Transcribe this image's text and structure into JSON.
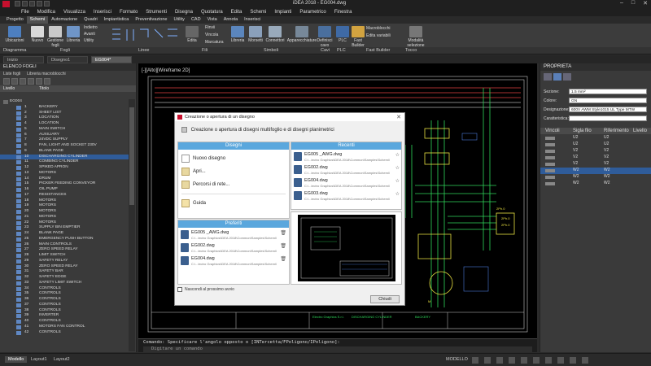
{
  "app": {
    "window_title": "iDEA 2018 - EG004.dwg"
  },
  "menu": [
    "File",
    "Modifica",
    "Visualizza",
    "Inserisci",
    "Formato",
    "Strumenti",
    "Disegna",
    "Quotatura",
    "Edita",
    "Schemi",
    "Impianti",
    "Parametrico",
    "Finestra"
  ],
  "ribbon_tabs": [
    "Progetto",
    "Schemi",
    "Automazione",
    "Quadri",
    "Impiantistica",
    "Preventivazione",
    "Utility",
    "CAD",
    "Vista",
    "Annota",
    "Inserisci"
  ],
  "ribbon_active_tab": "Schemi",
  "ribbon": {
    "buttons": {
      "ubicazioni": "Ubicazioni",
      "nuovo": "Nuovo",
      "gestione_fogli": "Gestione fogli",
      "libreria": "Libreria",
      "indietro": "Indietro",
      "avanti": "Avanti",
      "utility": "Utility",
      "edita": "Edita",
      "rinvii": "Rinvii",
      "vincola": "Vincola",
      "marcatura": "Marcatura",
      "libreria2": "Libreria",
      "morsetti": "Morsetti",
      "connettori": "Connettori",
      "apparecchiature": "Apparecchiature",
      "definisci_cavo": "Definisci cavo",
      "plc": "PLC",
      "macroblocchi": "Macroblocchi",
      "edita_variabili": "Edita variabili",
      "fast_builder": "Fast Builder",
      "modalita_selezione": "Modalità selezione"
    },
    "groups": [
      "Diagramma",
      "Fogli",
      "Linee",
      "Fili",
      "Simboli",
      "Cavi",
      "PLC",
      "Fast Builder",
      "Tocco"
    ]
  },
  "doc_tabs": [
    "Inizio",
    "Disegno1",
    "EG004*"
  ],
  "left_panel": {
    "title": "ELENCO FOGLI",
    "subtabs": [
      "Liste fogli",
      "Libreria macroblocchi"
    ],
    "columns": {
      "livello": "Livello",
      "titolo": "Titolo"
    },
    "root": "EG004",
    "sheets": [
      {
        "num": "1",
        "title": "BACKERY"
      },
      {
        "num": "2",
        "title": "SHEET LIST"
      },
      {
        "num": "3",
        "title": "LOCATION"
      },
      {
        "num": "4",
        "title": "LOCATION"
      },
      {
        "num": "5",
        "title": "MAIN SWITCH"
      },
      {
        "num": "6",
        "title": "AUXILIARY"
      },
      {
        "num": "7",
        "title": "24VDC SUPPLY"
      },
      {
        "num": "8",
        "title": "FAN, LIGHT AND SOCKET 230V"
      },
      {
        "num": "9",
        "title": "BLANK PAGE"
      },
      {
        "num": "10",
        "title": "DISCHARGING CYLINDER"
      },
      {
        "num": "11",
        "title": "COMBING CYLINDER"
      },
      {
        "num": "12",
        "title": "SPIKED APRON"
      },
      {
        "num": "13",
        "title": "MOTORS"
      },
      {
        "num": "14",
        "title": "DRUM"
      },
      {
        "num": "15",
        "title": "PICKER FEEDING CONVEYOR"
      },
      {
        "num": "16",
        "title": "OIL PUMP"
      },
      {
        "num": "17",
        "title": "RESISTANCES"
      },
      {
        "num": "18",
        "title": "MOTORS"
      },
      {
        "num": "19",
        "title": "MOTORS"
      },
      {
        "num": "20",
        "title": "MOTORS"
      },
      {
        "num": "21",
        "title": "MOTORS"
      },
      {
        "num": "22",
        "title": "MOTORS"
      },
      {
        "num": "23",
        "title": "SUPPLY BIN EMPTIER"
      },
      {
        "num": "24",
        "title": "BLANK PAGE"
      },
      {
        "num": "25",
        "title": "EMERGENCY PUSH BUTTON"
      },
      {
        "num": "26",
        "title": "MAIN CONTROLS"
      },
      {
        "num": "27",
        "title": "ZERO SPEED RELAY"
      },
      {
        "num": "28",
        "title": "LIMIT SWITCH"
      },
      {
        "num": "29",
        "title": "SAFETY RELAY"
      },
      {
        "num": "30",
        "title": "ZERO SPEED RELAY"
      },
      {
        "num": "31",
        "title": "SAFETY BAR"
      },
      {
        "num": "32",
        "title": "SAFETY EDGE"
      },
      {
        "num": "33",
        "title": "SAFETY LIMIT SWITCH"
      },
      {
        "num": "34",
        "title": "CONTROLS"
      },
      {
        "num": "35",
        "title": "CONTROLS"
      },
      {
        "num": "36",
        "title": "CONTROLS"
      },
      {
        "num": "37",
        "title": "CONTROLS"
      },
      {
        "num": "38",
        "title": "CONTROLS"
      },
      {
        "num": "39",
        "title": "INVERTER"
      },
      {
        "num": "40",
        "title": "CONTROLS"
      },
      {
        "num": "41",
        "title": "MOTORS FAN CONTROL"
      },
      {
        "num": "42",
        "title": "CONTROLS"
      }
    ],
    "selected_index": 9
  },
  "properties": {
    "title": "PROPRIETA",
    "fields": [
      {
        "label": "Sezione:",
        "value": "1.5 mm²"
      },
      {
        "label": "Colore:",
        "value": "GN"
      },
      {
        "label": "Designazione:",
        "value": "600V AWM Style1015 UL Type MTW"
      },
      {
        "label": "Caratteristica:",
        "value": ""
      }
    ],
    "wire_columns": {
      "vincoli": "Vincoli",
      "sigla": "Sigla filo",
      "riferimento": "Riferimento",
      "livello": "Livello"
    },
    "wires": [
      {
        "sigla": "U2",
        "rif": "U2"
      },
      {
        "sigla": "U2",
        "rif": "U2"
      },
      {
        "sigla": "V2",
        "rif": "V2"
      },
      {
        "sigla": "V2",
        "rif": "V2"
      },
      {
        "sigla": "V2",
        "rif": "V2"
      },
      {
        "sigla": "W2",
        "rif": "W2"
      },
      {
        "sigla": "W2",
        "rif": "W2"
      },
      {
        "sigla": "W2",
        "rif": "W2"
      }
    ],
    "selected_wire": 5
  },
  "command": {
    "line1": "Comando: Specificare l'angolo opposto o [INTercetta/FPoligono/IPoligono]:",
    "prompt": "Digitare un comando"
  },
  "status": {
    "tabs": [
      "Modello",
      "Layout1",
      "Layout2"
    ],
    "mode": "MODELLO"
  },
  "dialog": {
    "title": "Creazione o apertura di un disegno",
    "heading": "Creazione o apertura di disegni multifoglio e di disegni planimetrici",
    "disegni_header": "Disegni",
    "actions": [
      "Nuovo disegno",
      "Apri...",
      "Percorsi di rete...",
      "Guida"
    ],
    "recenti_header": "Recenti",
    "recenti": [
      {
        "name": "EG005 _AWG.dwg",
        "path": "C:\\...lectro Graphics\\iDEA 2018\\Common\\Samples\\Schemi\\"
      },
      {
        "name": "EG002.dwg",
        "path": "C:\\...lectro Graphics\\iDEA 2018\\Common\\Samples\\Schemi\\"
      },
      {
        "name": "EG004.dwg",
        "path": "C:\\...lectro Graphics\\iDEA 2018\\Common\\Samples\\Schemi\\"
      },
      {
        "name": "EG003.dwg",
        "path": "C:\\...lectro Graphics\\iDEA 2018\\Common\\Samples\\Schemi\\"
      }
    ],
    "preferiti_header": "Preferiti",
    "preferiti": [
      {
        "name": "EG005 _AWG.dwg",
        "path": "C:\\...lectro Graphics\\iDEA 2018\\Common\\Samples\\Schemi\\"
      },
      {
        "name": "EG002.dwg",
        "path": "C:\\...lectro Graphics\\iDEA 2018\\Common\\Samples\\Schemi\\"
      },
      {
        "name": "EG004.dwg",
        "path": "C:\\...lectro Graphics\\iDEA 2018\\Common\\Samples\\Schemi\\"
      }
    ],
    "checkbox": "Nascondi al prossimo avvio",
    "close": "Chiudi"
  },
  "canvas": {
    "viewport_label": "[-][Alto][Wireframe 2D]",
    "title_block": {
      "company": "Electro Graphics S.r.l.",
      "drawing": "DISCHARGING CYLINDER",
      "customer": "BACKERY"
    }
  }
}
